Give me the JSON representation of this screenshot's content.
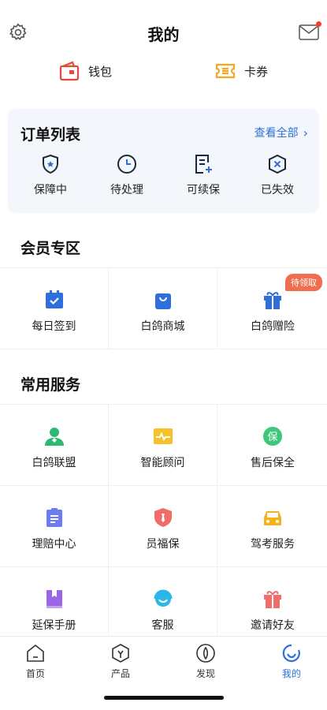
{
  "header": {
    "title": "我的",
    "has_unread_mail": true
  },
  "quick": {
    "wallet": "钱包",
    "coupons": "卡券"
  },
  "orders": {
    "title": "订单列表",
    "view_all": "查看全部",
    "items": [
      {
        "label": "保障中",
        "icon": "shield-star-icon"
      },
      {
        "label": "待处理",
        "icon": "clock-icon"
      },
      {
        "label": "可续保",
        "icon": "doc-plus-icon"
      },
      {
        "label": "已失效",
        "icon": "shield-x-icon"
      }
    ]
  },
  "member": {
    "title": "会员专区",
    "items": [
      {
        "label": "每日签到",
        "icon": "calendar-check-icon"
      },
      {
        "label": "白鸽商城",
        "icon": "shopping-bag-icon"
      },
      {
        "label": "白鸽赠险",
        "icon": "gift-icon",
        "badge": "待领取"
      }
    ]
  },
  "services": {
    "title": "常用服务",
    "items": [
      {
        "label": "白鸽联盟",
        "icon": "user-group-icon"
      },
      {
        "label": "智能顾问",
        "icon": "pulse-icon"
      },
      {
        "label": "售后保全",
        "icon": "bao-circle-icon"
      },
      {
        "label": "理赔中心",
        "icon": "clipboard-icon"
      },
      {
        "label": "员福保",
        "icon": "shield-tie-icon"
      },
      {
        "label": "驾考服务",
        "icon": "car-icon"
      },
      {
        "label": "延保手册",
        "icon": "book-icon"
      },
      {
        "label": "客服",
        "icon": "headset-icon"
      },
      {
        "label": "邀请好友",
        "icon": "gift-box-icon"
      }
    ]
  },
  "tabbar": {
    "tabs": [
      {
        "label": "首页",
        "icon": "home-icon"
      },
      {
        "label": "产品",
        "icon": "product-icon"
      },
      {
        "label": "发现",
        "icon": "discover-icon"
      },
      {
        "label": "我的",
        "icon": "profile-icon",
        "active": true
      }
    ]
  },
  "colors": {
    "accent": "#2f6fdd",
    "badge": "#f06d4f",
    "wallet": "#e84a3a",
    "coupon": "#f5a623"
  }
}
